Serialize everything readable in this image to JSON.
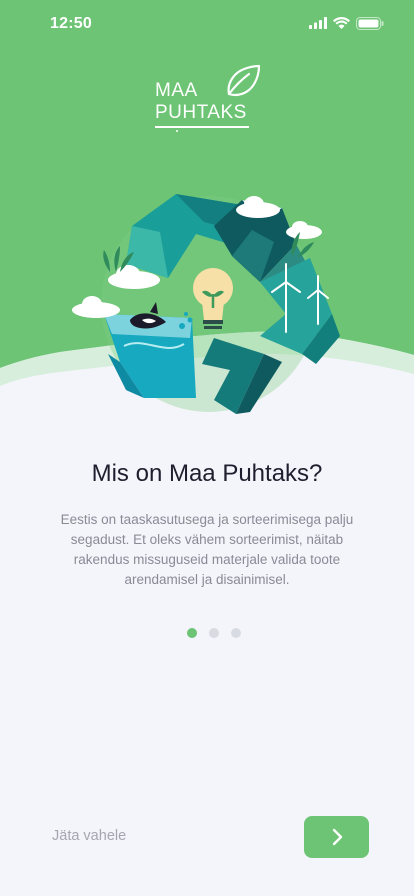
{
  "status_bar": {
    "time": "12:50",
    "icons": [
      "cellular-signal-icon",
      "wifi-icon",
      "battery-icon"
    ]
  },
  "logo": {
    "line1": "MAA",
    "line2": "PUHTAKS",
    "icon": "leaf-icon"
  },
  "illustration": {
    "name": "recycle-nature-illustration",
    "icons": [
      "recycle-icon",
      "lightbulb-icon",
      "wind-turbine-icon",
      "orca-icon",
      "cloud-icon"
    ]
  },
  "content": {
    "title": "Mis on Maa Puhtaks?",
    "description": "Eestis on taaskasutusega ja sorteerimisega palju segadust. Et oleks vähem sorteerimist, näitab rakendus missuguseid materjale valida toote arendamisel ja disainimisel."
  },
  "pager": {
    "total": 3,
    "active_index": 0
  },
  "footer": {
    "skip_label": "Jäta vahele",
    "next_icon": "chevron-right-icon"
  },
  "colors": {
    "brand_green": "#6cc474",
    "background": "#f4f5fa",
    "title": "#1e1e2e",
    "body_text": "#8a8a96",
    "teal": "#1a9e9a",
    "dark_teal": "#0f5a5e"
  }
}
